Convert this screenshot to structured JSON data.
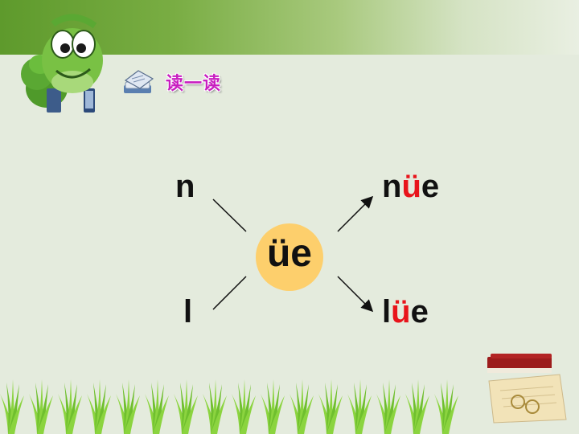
{
  "heading": "读一读",
  "initials": {
    "n": "n",
    "l": "l"
  },
  "final": "üe",
  "results": {
    "nue": {
      "prefix": "n",
      "highlight": "ü",
      "suffix": "e"
    },
    "lue": {
      "prefix": "l",
      "highlight": "ü",
      "suffix": "e"
    }
  },
  "colors": {
    "highlight": "#e8141b",
    "circle": "#fdcf6c",
    "heading": "#c81ec0",
    "background": "#e4ebdd"
  },
  "icons": [
    "caterpillar-mascot-icon",
    "open-book-icon",
    "grass-decoration",
    "book-glasses-icon"
  ]
}
